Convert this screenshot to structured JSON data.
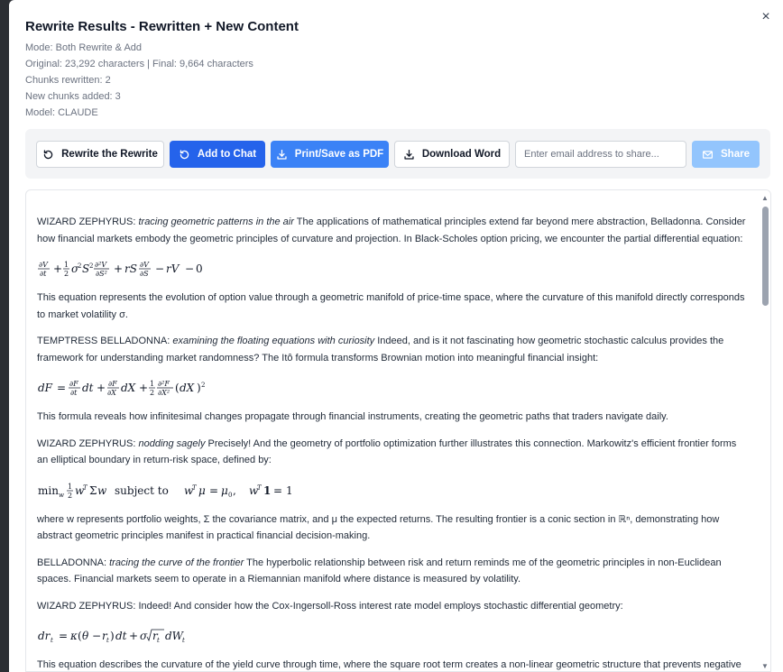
{
  "modal": {
    "title": "Rewrite Results - Rewritten + New Content",
    "close_glyph": "×",
    "meta": {
      "mode": "Mode: Both Rewrite & Add",
      "chars": "Original: 23,292 characters | Final: 9,664 characters",
      "chunks_rewritten": "Chunks rewritten: 2",
      "chunks_added": "New chunks added: 3",
      "model": "Model: CLAUDE"
    }
  },
  "toolbar": {
    "rewrite_label": "Rewrite the Rewrite",
    "add_chat_label": "Add to Chat",
    "print_label": "Print/Save as PDF",
    "download_label": "Download Word",
    "email_placeholder": "Enter email address to share...",
    "share_label": "Share"
  },
  "icons": {
    "rewrite": "rotate-ccw-icon",
    "add_chat": "refresh-icon",
    "print": "download-icon",
    "download": "download-icon",
    "share": "mail-icon",
    "close": "close-icon"
  },
  "colors": {
    "primary": "#2563eb",
    "print": "#3b82f6",
    "share_disabled": "#93c5fd"
  },
  "content": {
    "p1": {
      "speaker": "WIZARD ZEPHYRUS:",
      "action": "tracing geometric patterns in the air",
      "text": "The applications of mathematical principles extend far beyond mere abstraction, Belladonna. Consider how financial markets embody the geometric principles of curvature and projection. In Black-Scholes option pricing, we encounter the partial differential equation:"
    },
    "p2_text": "This equation represents the evolution of option value through a geometric manifold of price-time space, where the curvature of this manifold directly corresponds to market volatility σ.",
    "p3": {
      "speaker": "TEMPTRESS BELLADONNA:",
      "action": "examining the floating equations with curiosity",
      "text": "Indeed, and is it not fascinating how geometric stochastic calculus provides the framework for understanding market randomness? The Itô formula transforms Brownian motion into meaningful financial insight:"
    },
    "p4_text": "This formula reveals how infinitesimal changes propagate through financial instruments, creating the geometric paths that traders navigate daily.",
    "p5": {
      "speaker": "WIZARD ZEPHYRUS:",
      "action": "nodding sagely",
      "text": "Precisely! And the geometry of portfolio optimization further illustrates this connection. Markowitz's efficient frontier forms an elliptical boundary in return-risk space, defined by:"
    },
    "p6_text": "where w represents portfolio weights, Σ the covariance matrix, and μ the expected returns. The resulting frontier is a conic section in ℝⁿ, demonstrating how abstract geometric principles manifest in practical financial decision-making.",
    "p7": {
      "speaker": "BELLADONNA:",
      "action": "tracing the curve of the frontier",
      "text": "The hyperbolic relationship between risk and return reminds me of the geometric principles in non-Euclidean spaces. Financial markets seem to operate in a Riemannian manifold where distance is measured by volatility."
    },
    "p8": {
      "speaker": "WIZARD ZEPHYRUS:",
      "text": "Indeed! And consider how the Cox-Ingersoll-Ross interest rate model employs stochastic differential geometry:"
    },
    "p9_text": "This equation describes the curvature of the yield curve through time, where the square root term creates a non-linear geometric structure that prevents negative interest rates—a topological constraint with profound economic implications."
  }
}
